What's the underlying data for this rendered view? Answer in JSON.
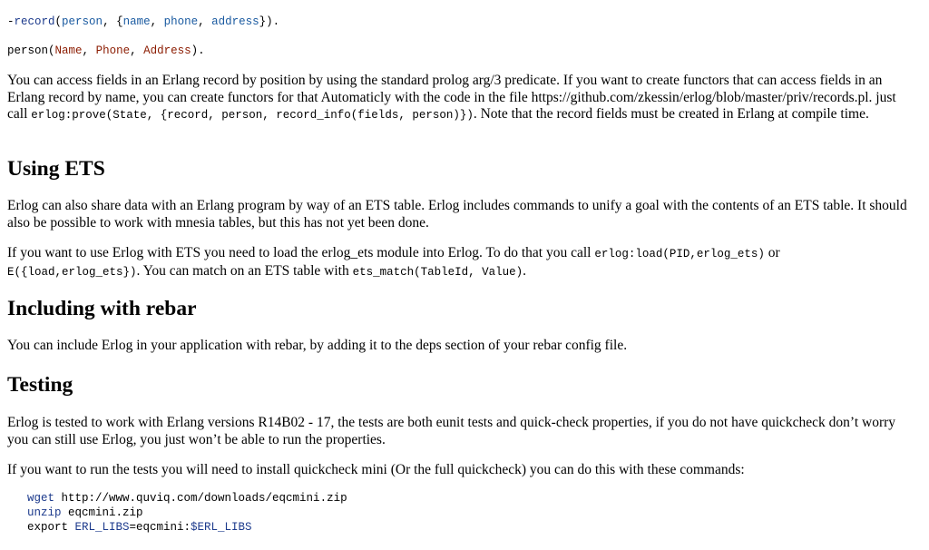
{
  "code_top": {
    "line1": {
      "dash": "-",
      "kw": "record",
      "open": "(",
      "atom1": "person",
      "sep1": ", {",
      "f1": "name",
      "sep2": ", ",
      "f2": "phone",
      "sep3": ", ",
      "f3": "address",
      "close": "})."
    },
    "line2": {
      "atom": "person",
      "open": "(",
      "v1": "Name",
      "sep1": ", ",
      "v2": "Phone",
      "sep2": ", ",
      "v3": "Address",
      "close": ")."
    }
  },
  "para1": {
    "text1": "You can access fields in an Erlang record by position by using the standard prolog arg/3 predicate. If you want to create functors that can access fields in an Erlang record by name, you can create functors for that Automaticly with the code in the file https://github.com/zkessin/erlog/blob/master/priv/records.pl. just call ",
    "code1": "erlog:prove(State, {record, person, record_info(fields, person)})",
    "text2": ". Note that the record fields must be created in Erlang at compile time."
  },
  "h_ets": "Using ETS",
  "para2": "Erlog can also share data with an Erlang program by way of an ETS table. Erlog includes commands to unify a goal with the contents of an ETS table. It should also be possible to work with mnesia tables, but this has not yet been done.",
  "para3": {
    "text1": "If you want to use Erlog with ETS you need to load the erlog_ets module into Erlog. To do that you call ",
    "code1": "erlog:load(PID,erlog_ets)",
    "text2": " or ",
    "code2": "E({load,erlog_ets})",
    "text3": ". You can match on an ETS table with ",
    "code3": "ets_match(TableId, Value)",
    "text4": "."
  },
  "h_rebar": "Including with rebar",
  "para4": "You can include Erlog in your application with rebar, by adding it to the deps section of your rebar config file.",
  "h_testing": "Testing",
  "para5": "Erlog is tested to work with Erlang versions R14B02 - 17, the tests are both eunit tests and quick-check properties, if you do not have quickcheck don’t worry you can still use Erlog, you just won’t be able to run the properties.",
  "para6": "If you want to run the tests you will need to install quickcheck mini (Or the full quickcheck) you can do this with these commands:",
  "shell": {
    "l1_cmd": "wget",
    "l1_arg": " http://www.quviq.com/downloads/eqcmini.zip",
    "l2_cmd": "unzip",
    "l2_arg": " eqcmini.zip",
    "l3_cmd": "export ",
    "l3_var": "ERL_LIBS",
    "l3_eq": "=eqcmini:",
    "l3_ref": "$ERL_LIBS"
  }
}
